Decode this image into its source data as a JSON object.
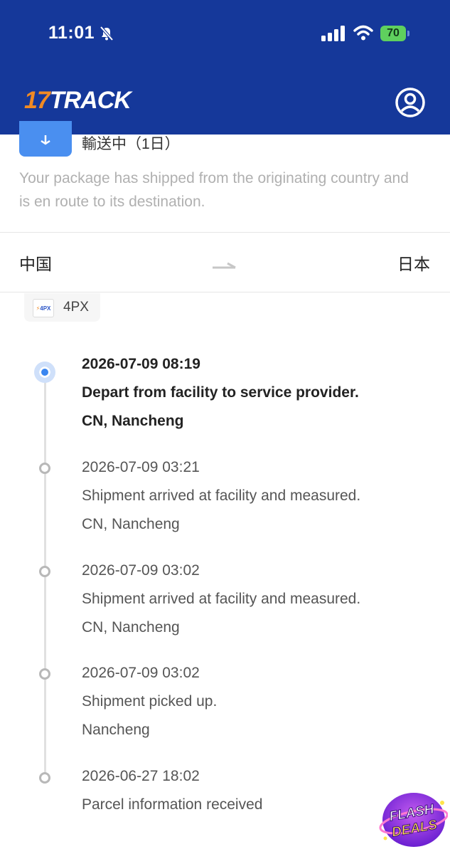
{
  "status_bar": {
    "time": "11:01",
    "battery": "70"
  },
  "app": {
    "logo_number": "17",
    "logo_text": "TRACK"
  },
  "package": {
    "status_label": "輸送中（1日）",
    "description": "Your package has shipped from the originating country and is en route to its destination."
  },
  "route": {
    "origin": "中国",
    "destination": "日本"
  },
  "carrier": {
    "logo_text": "4PX",
    "name": "4PX"
  },
  "events": [
    {
      "datetime": "2026-07-09 08:19",
      "description": "Depart from facility to service provider.",
      "location": "CN, Nancheng"
    },
    {
      "datetime": "2026-07-09 03:21",
      "description": "Shipment arrived at facility and measured.",
      "location": "CN, Nancheng"
    },
    {
      "datetime": "2026-07-09 03:02",
      "description": "Shipment arrived at facility and measured.",
      "location": "CN, Nancheng"
    },
    {
      "datetime": "2026-07-09 03:02",
      "description": "Shipment picked up.",
      "location": "Nancheng"
    },
    {
      "datetime": "2026-06-27 18:02",
      "description": "Parcel information received",
      "location": ""
    }
  ],
  "promo": {
    "line1": "FLASH",
    "line2": "DEALS"
  },
  "colors": {
    "header_bg": "#15389a",
    "logo_accent": "#f08a24",
    "active_dot": "#3a86f0",
    "status_icon_bg": "#4a8ff0"
  }
}
